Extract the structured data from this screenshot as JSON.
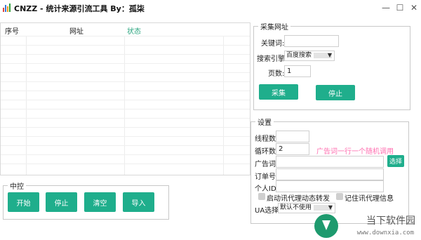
{
  "window": {
    "title": "CNZZ - 统计来源引流工具 By：孤柒",
    "minimize": "—",
    "maximize": "☐",
    "close": "✕"
  },
  "table": {
    "columns": [
      "序号",
      "网址",
      "状态"
    ],
    "status_color": "#2aa57f",
    "rows": []
  },
  "collect": {
    "legend": "采集网址",
    "keyword_label": "关键词:",
    "keyword_value": "",
    "engine_label": "搜索引擎:",
    "engine_value": "百度搜索",
    "pages_label": "页数:",
    "pages_value": "1",
    "collect_button": "采集",
    "stop_button": "停止"
  },
  "settings": {
    "legend": "设置",
    "threads_label": "线程数:",
    "threads_value": "",
    "loops_label": "循环数:",
    "loops_value": "2",
    "ad_hint": "广告词一行一个随机调用",
    "ad_hint_color": "#ff6fb0",
    "ad_label": "广告词:",
    "ad_value": "",
    "select_button": "选择",
    "order_label": "订单号:",
    "order_value": "",
    "personal_label": "个人ID:",
    "personal_value": "",
    "proxy_check_label": "启动讯代理动态转发",
    "remember_check_label": "记住讯代理信息",
    "ua_label": "UA选择:",
    "ua_value": "默认不使用"
  },
  "control": {
    "legend": "中控",
    "start_button": "开始",
    "stop_button": "停止",
    "clear_button": "清空",
    "import_button": "导入"
  },
  "watermark": {
    "brand": "当下软件园",
    "url": "www.downxia.com"
  },
  "colors": {
    "accent": "#1fae8c"
  }
}
